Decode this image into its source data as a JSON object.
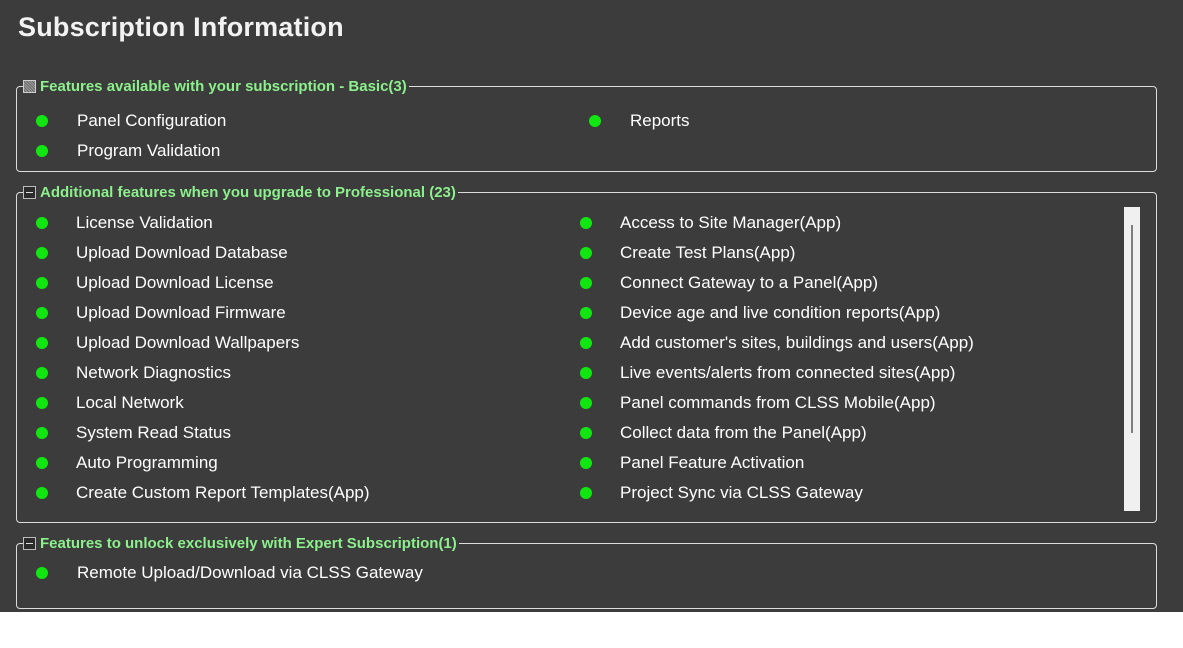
{
  "page": {
    "title": "Subscription Information"
  },
  "groups": {
    "basic": {
      "title": "Features available with your subscription - Basic(3)",
      "items": [
        "Panel Configuration",
        "Program Validation",
        "Reports"
      ]
    },
    "professional": {
      "title": "Additional features when you upgrade to Professional (23)",
      "items": [
        "License Validation",
        "Upload Download Database",
        "Upload Download License",
        "Upload Download Firmware",
        "Upload Download Wallpapers",
        "Network Diagnostics",
        "Local Network",
        "System Read Status",
        "Auto Programming",
        "Create Custom Report Templates(App)",
        "Access to Site Manager(App)",
        "Create Test Plans(App)",
        "Connect Gateway to a Panel(App)",
        "Device age and live condition reports(App)",
        "Add customer's sites, buildings and users(App)",
        "Live events/alerts from connected sites(App)",
        "Panel commands from CLSS Mobile(App)",
        "Collect data from the Panel(App)",
        "Panel Feature Activation",
        "Project Sync via CLSS Gateway"
      ]
    },
    "expert": {
      "title": "Features to unlock exclusively with Expert Subscription(1)",
      "items": [
        "Remote Upload/Download via CLSS Gateway"
      ]
    }
  },
  "colors": {
    "background": "#3c3c3c",
    "legend_text": "#8cf08c",
    "status_dot": "#11e611"
  }
}
